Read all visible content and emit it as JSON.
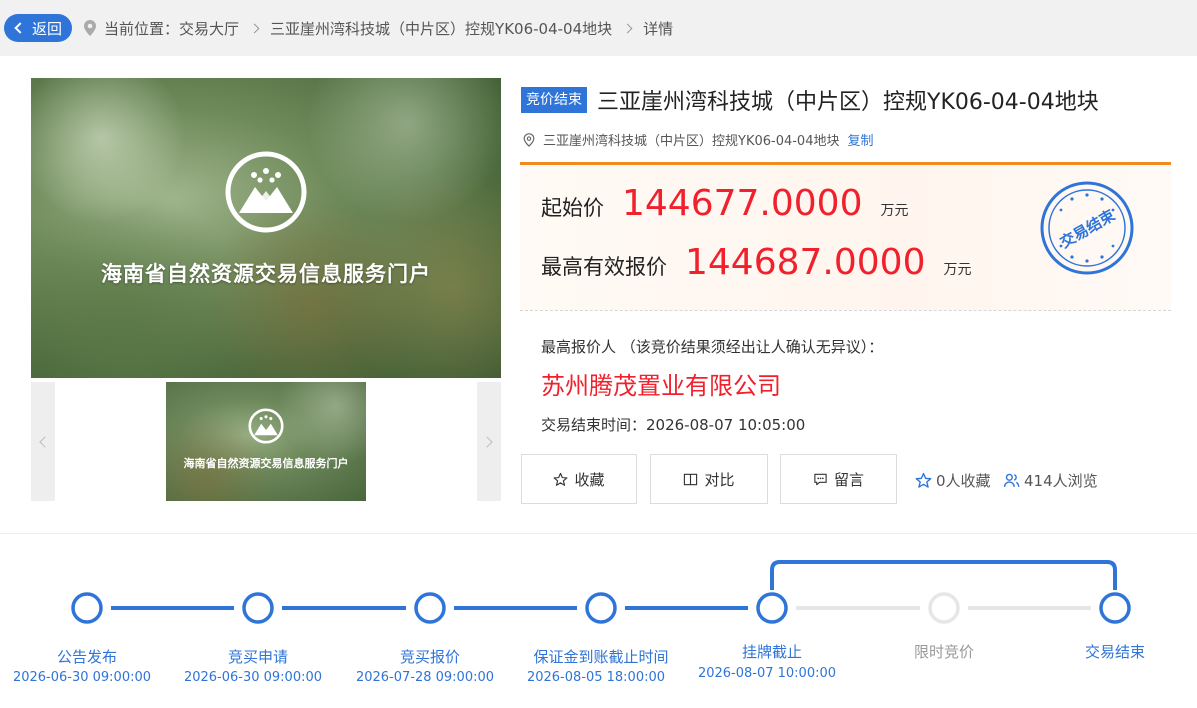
{
  "breadcrumb": {
    "back_label": "返回",
    "location_prefix": "当前位置：",
    "items": [
      "交易大厅",
      "三亚崖州湾科技城（中片区）控规YK06-04-04地块",
      "详情"
    ]
  },
  "gallery": {
    "hero_caption": "海南省自然资源交易信息服务门户",
    "thumb_caption": "海南省自然资源交易信息服务门户"
  },
  "listing": {
    "status_tag": "竞价结束",
    "title": "三亚崖州湾科技城（中片区）控规YK06-04-04地块",
    "location": "三亚崖州湾科技城（中片区）控规YK06-04-04地块",
    "copy_label": "复制",
    "start_price_label": "起始价",
    "start_price": "144677.0000",
    "highest_price_label": "最高有效报价",
    "highest_price": "144687.0000",
    "unit": "万元",
    "stamp_text": "交易结束",
    "bidder_label": "最高报价人 （该竞价结果须经出让人确认无异议）：",
    "bidder_name": "苏州腾茂置业有限公司",
    "end_time": "交易结束时间：2026-08-07 10:05:00"
  },
  "actions": {
    "favorite": "收藏",
    "compare": "对比",
    "message": "留言"
  },
  "stats": {
    "favorites": "0人收藏",
    "views": "414人浏览"
  },
  "timeline": [
    {
      "label": "公告发布",
      "date": "2026-06-30 09:00:00",
      "state": "done"
    },
    {
      "label": "竞买申请",
      "date": "2026-06-30 09:00:00",
      "state": "done"
    },
    {
      "label": "竞买报价",
      "date": "2026-07-28 09:00:00",
      "state": "done"
    },
    {
      "label": "保证金到账截止时间",
      "date": "2026-08-05 18:00:00",
      "state": "done"
    },
    {
      "label": "挂牌截止",
      "date": "2026-08-07 10:00:00",
      "state": "done"
    },
    {
      "label": "限时竞价",
      "date": "",
      "state": "skipped"
    },
    {
      "label": "交易结束",
      "date": "",
      "state": "done"
    }
  ],
  "colors": {
    "accent": "#2f74d8",
    "price": "#f0202d",
    "orange": "#f08b1f",
    "inactive": "#e6e6e6"
  }
}
